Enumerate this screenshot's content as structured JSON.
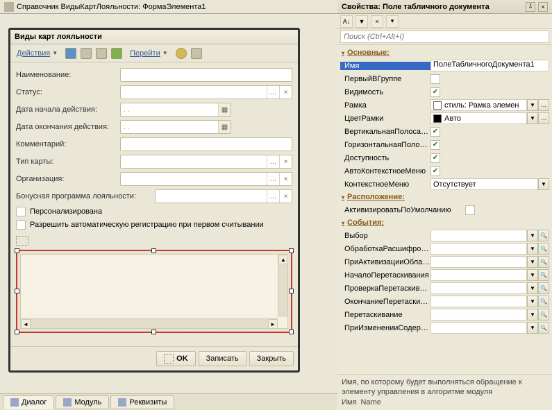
{
  "designer": {
    "window_title": "Справочник ВидыКартЛояльности: ФормаЭлемента1",
    "form_title": "Виды карт лояльности",
    "toolbar": {
      "actions_label": "Действия",
      "goto_label": "Перейти"
    },
    "fields": {
      "name_label": "Наименование:",
      "status_label": "Статус:",
      "date_start_label": "Дата начала действия:",
      "date_end_label": "Дата окончания действия:",
      "comment_label": "Комментарий:",
      "card_type_label": "Тип карты:",
      "org_label": "Организация:",
      "bonus_prog_label": "Бонусная программа лояльности:",
      "date_placeholder_start": " .  .",
      "date_placeholder_end": " .  .",
      "personalized_label": "Персонализирована",
      "autoreg_label": "Разрешить автоматическую регистрацию при первом считывании"
    },
    "buttons": {
      "ok": "OK",
      "save": "Записать",
      "close": "Закрыть"
    },
    "tabs": {
      "dialog": "Диалог",
      "module": "Модуль",
      "attrs": "Реквизиты"
    }
  },
  "props": {
    "panel_title": "Свойства: Поле табличного документа",
    "search_placeholder": "Поиск (Ctrl+Alt+I)",
    "groups": {
      "main": "Основные:",
      "layout": "Расположение:",
      "events": "События:"
    },
    "main": {
      "name_label": "Имя",
      "name_value": "ПолеТабличногоДокумента1",
      "first_in_group": "ПервыйВГруппе",
      "visibility": "Видимость",
      "frame_label": "Рамка",
      "frame_value": "стиль: Рамка элемен",
      "frame_color_label": "ЦветРамки",
      "frame_color_value": "Авто",
      "vscroll": "ВертикальнаяПолосаПро",
      "hscroll": "ГоризонтальнаяПолосаП",
      "enabled": "Доступность",
      "auto_ctx": "АвтоКонтекстноеМеню",
      "ctx_label": "КонтекстноеМеню",
      "ctx_value": "Отсутствует"
    },
    "layout": {
      "activate_default": "АктивизироватьПоУмолчанию"
    },
    "events": {
      "select": "Выбор",
      "drill": "ОбработкаРасшифровки",
      "activate_area": "ПриАктивизацииОбласти",
      "drag_start": "НачалоПеретаскивания",
      "drag_check": "ПроверкаПеретаскивани",
      "drag_end": "ОкончаниеПеретаскиван",
      "drag": "Перетаскивание",
      "content_change": "ПриИзмененииСодержим"
    },
    "footer_help": "Имя, по которому будет выполняться обращение к элементу управления в алгоритме модуля",
    "footer_prop": "Имя  Name"
  }
}
